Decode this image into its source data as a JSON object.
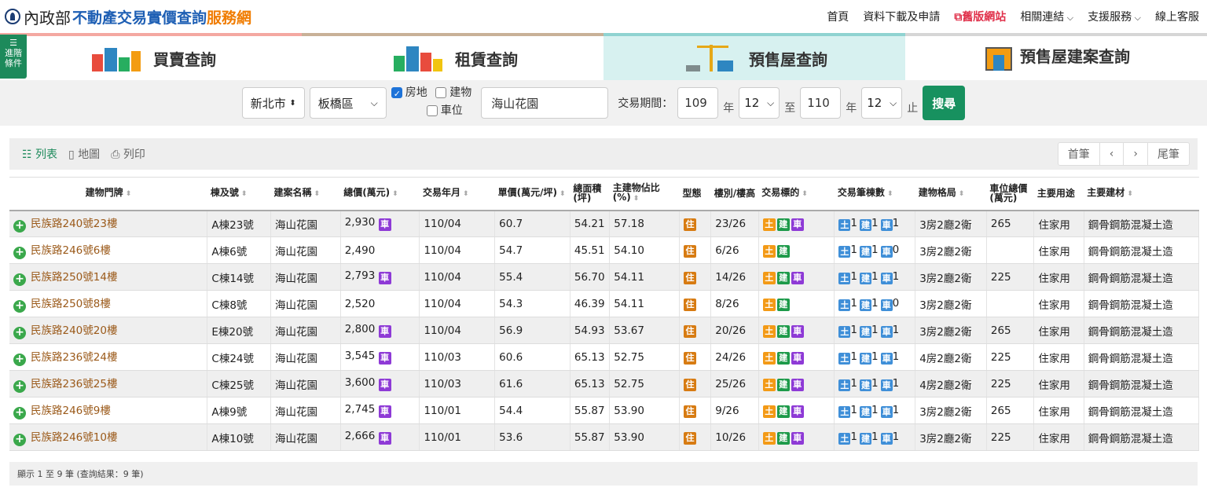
{
  "header": {
    "ministry": "內政部",
    "site_name_blue": "不動產交易實價查詢",
    "site_name_orange": "服務網",
    "nav": [
      "首頁",
      "資料下載及申請",
      "舊版網站",
      "相關連結",
      "支援服務",
      "線上客服"
    ]
  },
  "tabs": [
    "買賣查詢",
    "租賃查詢",
    "預售屋查詢",
    "預售屋建案查詢"
  ],
  "advanced_label": [
    "進階",
    "條件"
  ],
  "search": {
    "city": "新北市",
    "district": "板橋區",
    "opt_land_building": "房地",
    "opt_building": "建物",
    "opt_parking": "車位",
    "keyword": "海山花園",
    "period_label": "交易期間：",
    "from_year": "109",
    "year_unit": "年",
    "from_month": "12",
    "to_label": "至",
    "to_year": "110",
    "to_month": "12",
    "end_label": "止",
    "submit": "搜尋"
  },
  "toolbar": {
    "list": "列表",
    "map": "地圖",
    "print": "列印",
    "first": "首筆",
    "prev": "‹",
    "next": "›",
    "last": "尾筆"
  },
  "table": {
    "headers": [
      "建物門牌",
      "棟及號",
      "建案名稱",
      "總價(萬元)",
      "交易年月",
      "單價(萬元/坪)",
      "總面積(坪)",
      "主建物佔比(%)",
      "型態",
      "樓別/樓高",
      "交易標的",
      "交易筆棟數",
      "建物格局",
      "車位總價(萬元)",
      "主要用途",
      "主要建材"
    ],
    "badge_car": "車",
    "badge_live": "住",
    "badge_land": "土",
    "badge_bldg": "建",
    "rows": [
      {
        "addr": "民族路240號23樓",
        "unit": "A棟23號",
        "project": "海山花園",
        "price": "2,930",
        "car": true,
        "date": "110/04",
        "unit_price": "60.7",
        "area": "54.21",
        "ratio": "57.18",
        "floor": "23/26",
        "p": "1",
        "b": "1",
        "c": "1",
        "layout": "3房2廳2衛",
        "car_price": "265",
        "use": "住家用",
        "material": "鋼骨鋼筋混凝土造"
      },
      {
        "addr": "民族路246號6樓",
        "unit": "A棟6號",
        "project": "海山花園",
        "price": "2,490",
        "car": false,
        "date": "110/04",
        "unit_price": "54.7",
        "area": "45.51",
        "ratio": "54.10",
        "floor": "6/26",
        "p": "1",
        "b": "1",
        "c": "0",
        "layout": "3房2廳2衛",
        "car_price": "",
        "use": "住家用",
        "material": "鋼骨鋼筋混凝土造"
      },
      {
        "addr": "民族路250號14樓",
        "unit": "C棟14號",
        "project": "海山花園",
        "price": "2,793",
        "car": true,
        "date": "110/04",
        "unit_price": "55.4",
        "area": "56.70",
        "ratio": "54.11",
        "floor": "14/26",
        "p": "1",
        "b": "1",
        "c": "1",
        "layout": "3房2廳2衛",
        "car_price": "225",
        "use": "住家用",
        "material": "鋼骨鋼筋混凝土造"
      },
      {
        "addr": "民族路250號8樓",
        "unit": "C棟8號",
        "project": "海山花園",
        "price": "2,520",
        "car": false,
        "date": "110/04",
        "unit_price": "54.3",
        "area": "46.39",
        "ratio": "54.11",
        "floor": "8/26",
        "p": "1",
        "b": "1",
        "c": "0",
        "layout": "3房2廳2衛",
        "car_price": "",
        "use": "住家用",
        "material": "鋼骨鋼筋混凝土造"
      },
      {
        "addr": "民族路240號20樓",
        "unit": "E棟20號",
        "project": "海山花園",
        "price": "2,800",
        "car": true,
        "date": "110/04",
        "unit_price": "56.9",
        "area": "54.93",
        "ratio": "53.67",
        "floor": "20/26",
        "p": "1",
        "b": "1",
        "c": "1",
        "layout": "3房2廳2衛",
        "car_price": "265",
        "use": "住家用",
        "material": "鋼骨鋼筋混凝土造"
      },
      {
        "addr": "民族路236號24樓",
        "unit": "C棟24號",
        "project": "海山花園",
        "price": "3,545",
        "car": true,
        "date": "110/03",
        "unit_price": "60.6",
        "area": "65.13",
        "ratio": "52.75",
        "floor": "24/26",
        "p": "1",
        "b": "1",
        "c": "1",
        "layout": "4房2廳2衛",
        "car_price": "225",
        "use": "住家用",
        "material": "鋼骨鋼筋混凝土造"
      },
      {
        "addr": "民族路236號25樓",
        "unit": "C棟25號",
        "project": "海山花園",
        "price": "3,600",
        "car": true,
        "date": "110/03",
        "unit_price": "61.6",
        "area": "65.13",
        "ratio": "52.75",
        "floor": "25/26",
        "p": "1",
        "b": "1",
        "c": "1",
        "layout": "4房2廳2衛",
        "car_price": "225",
        "use": "住家用",
        "material": "鋼骨鋼筋混凝土造"
      },
      {
        "addr": "民族路246號9樓",
        "unit": "A棟9號",
        "project": "海山花園",
        "price": "2,745",
        "car": true,
        "date": "110/01",
        "unit_price": "54.4",
        "area": "55.87",
        "ratio": "53.90",
        "floor": "9/26",
        "p": "1",
        "b": "1",
        "c": "1",
        "layout": "3房2廳2衛",
        "car_price": "265",
        "use": "住家用",
        "material": "鋼骨鋼筋混凝土造"
      },
      {
        "addr": "民族路246號10樓",
        "unit": "A棟10號",
        "project": "海山花園",
        "price": "2,666",
        "car": true,
        "date": "110/01",
        "unit_price": "53.6",
        "area": "55.87",
        "ratio": "53.90",
        "floor": "10/26",
        "p": "1",
        "b": "1",
        "c": "1",
        "layout": "3房2廳2衛",
        "car_price": "225",
        "use": "住家用",
        "material": "鋼骨鋼筋混凝土造"
      }
    ]
  },
  "footer": "顯示 1 至 9 筆 (查詢結果：9 筆)"
}
